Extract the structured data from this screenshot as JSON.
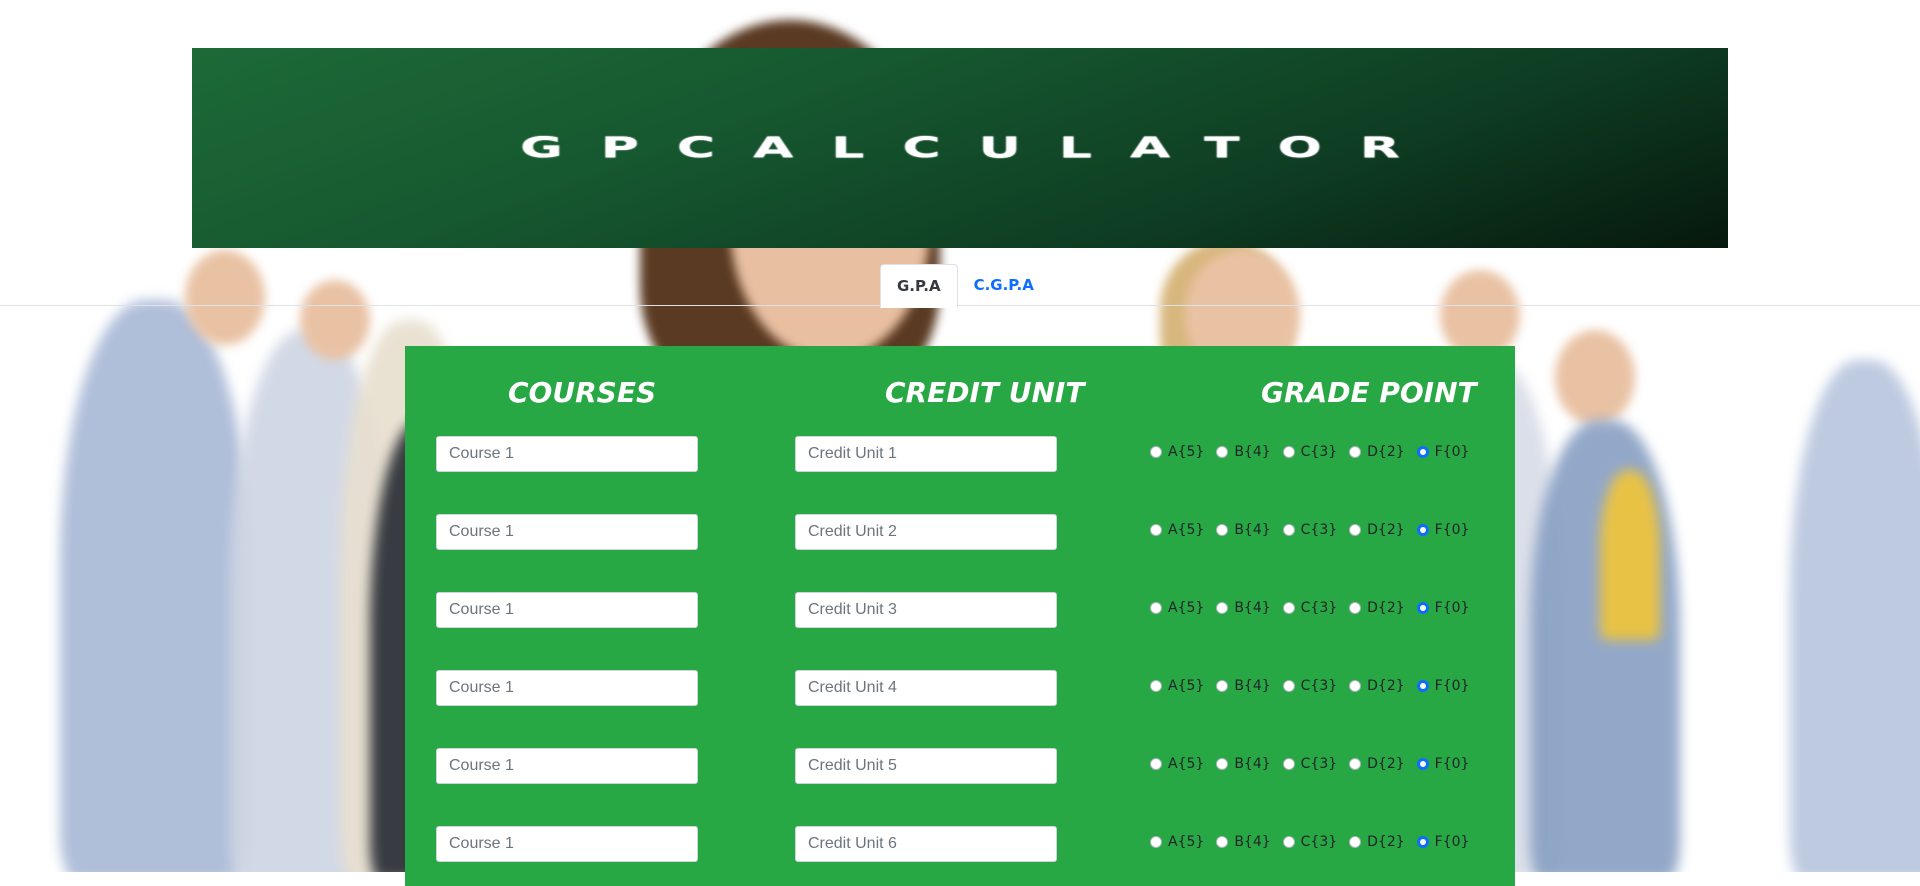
{
  "banner": {
    "title": "GPCALCULATOR"
  },
  "tabs": [
    {
      "label": "G.P.A",
      "active": true
    },
    {
      "label": "C.G.P.A",
      "active": false
    }
  ],
  "columns": {
    "courses": "COURSES",
    "credit_unit": "CREDIT UNIT",
    "grade_point": "GRADE POINT"
  },
  "grade_options": [
    "A{5}",
    "B{4}",
    "C{3}",
    "D{2}",
    "F{0}"
  ],
  "selected_grade": "F{0}",
  "rows": [
    {
      "course_placeholder": "Course 1",
      "credit_placeholder": "Credit Unit 1"
    },
    {
      "course_placeholder": "Course 1",
      "credit_placeholder": "Credit Unit 2"
    },
    {
      "course_placeholder": "Course 1",
      "credit_placeholder": "Credit Unit 3"
    },
    {
      "course_placeholder": "Course 1",
      "credit_placeholder": "Credit Unit 4"
    },
    {
      "course_placeholder": "Course 1",
      "credit_placeholder": "Credit Unit 5"
    },
    {
      "course_placeholder": "Course 1",
      "credit_placeholder": "Credit Unit 6"
    }
  ],
  "colors": {
    "banner": "#1d6a37",
    "panel": "#28a745",
    "tab_link": "#0d6efd",
    "radio_checked": "#0d6efd"
  }
}
